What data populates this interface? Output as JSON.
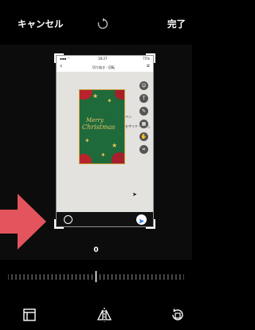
{
  "toolbar": {
    "cancel_label": "キャンセル",
    "done_label": "完了",
    "reset_icon": "rotate-reset-icon"
  },
  "photo": {
    "status_time": "18:27",
    "status_battery": "75%",
    "nav_title": "切り抜き・回転",
    "card_title_line1": "Merry",
    "card_title_line2": "Christmas",
    "card_side_text1": "ペン",
    "card_side_text2": "モザイク・ぼかし"
  },
  "rotation": {
    "angle_value": "0"
  },
  "bottom_tools": [
    "aspect-ratio-icon",
    "flip-horizontal-icon",
    "rotate-90-icon"
  ],
  "colors": {
    "background": "#000000",
    "annotation_arrow": "#e4545c",
    "card_green": "#1f6a3a",
    "gold": "#e4c36a"
  }
}
